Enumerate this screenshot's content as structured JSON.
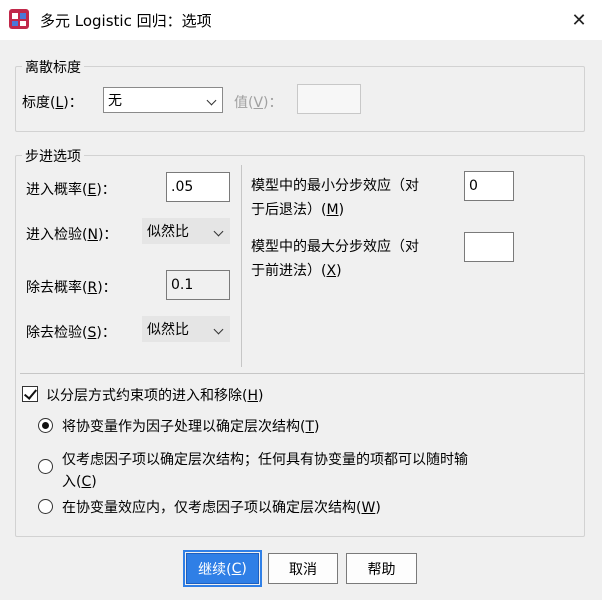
{
  "window": {
    "title": "多元 Logistic 回归：选项",
    "app_icon": "spss-icon",
    "close_icon": "close-icon"
  },
  "dispersion": {
    "legend": "离散标度",
    "scale_label_pre": "标度(",
    "scale_label_key": "L",
    "scale_label_post": ")：",
    "scale_value": "无",
    "value_label_pre": "值(",
    "value_label_key": "V",
    "value_label_post": ")：",
    "value_input": ""
  },
  "stepwise": {
    "legend": "步进选项",
    "entry_prob": {
      "pre": "进入概率(",
      "key": "E",
      "post": ")：",
      "value": ".05"
    },
    "entry_test": {
      "pre": "进入检验(",
      "key": "N",
      "post": ")：",
      "value": "似然比"
    },
    "removal_prob": {
      "pre": "除去概率(",
      "key": "R",
      "post": ")：",
      "value": "0.1"
    },
    "removal_test": {
      "pre": "除去检验(",
      "key": "S",
      "post": ")：",
      "value": "似然比"
    },
    "min_effects": {
      "line1": "模型中的最小分步效应（对",
      "line2_pre": "于后退法）(",
      "key": "M",
      "post": ")",
      "value": "0"
    },
    "max_effects": {
      "line1": "模型中的最大分步效应（对",
      "line2_pre": "于前进法）(",
      "key": "X",
      "post": ")",
      "value": ""
    },
    "hierarchy_checkbox": {
      "pre": "以分层方式约束项的进入和移除(",
      "key": "H",
      "post": ")",
      "checked": true
    },
    "radio1": {
      "pre": "将协变量作为因子处理以确定层次结构(",
      "key": "T",
      "post": ")",
      "selected": true
    },
    "radio2": {
      "line1": "仅考虑因子项以确定层次结构；任何具有协变量的项都可以随时输",
      "line2_pre": "入(",
      "key": "C",
      "post": ")",
      "selected": false
    },
    "radio3": {
      "pre": "在协变量效应内，仅考虑因子项以确定层次结构(",
      "key": "W",
      "post": ")",
      "selected": false
    }
  },
  "buttons": {
    "continue": {
      "pre": "继续(",
      "key": "C",
      "post": ")"
    },
    "cancel": "取消",
    "help": "帮助"
  },
  "colors": {
    "primary": "#2f7fe6",
    "background": "#f0f0f0"
  }
}
